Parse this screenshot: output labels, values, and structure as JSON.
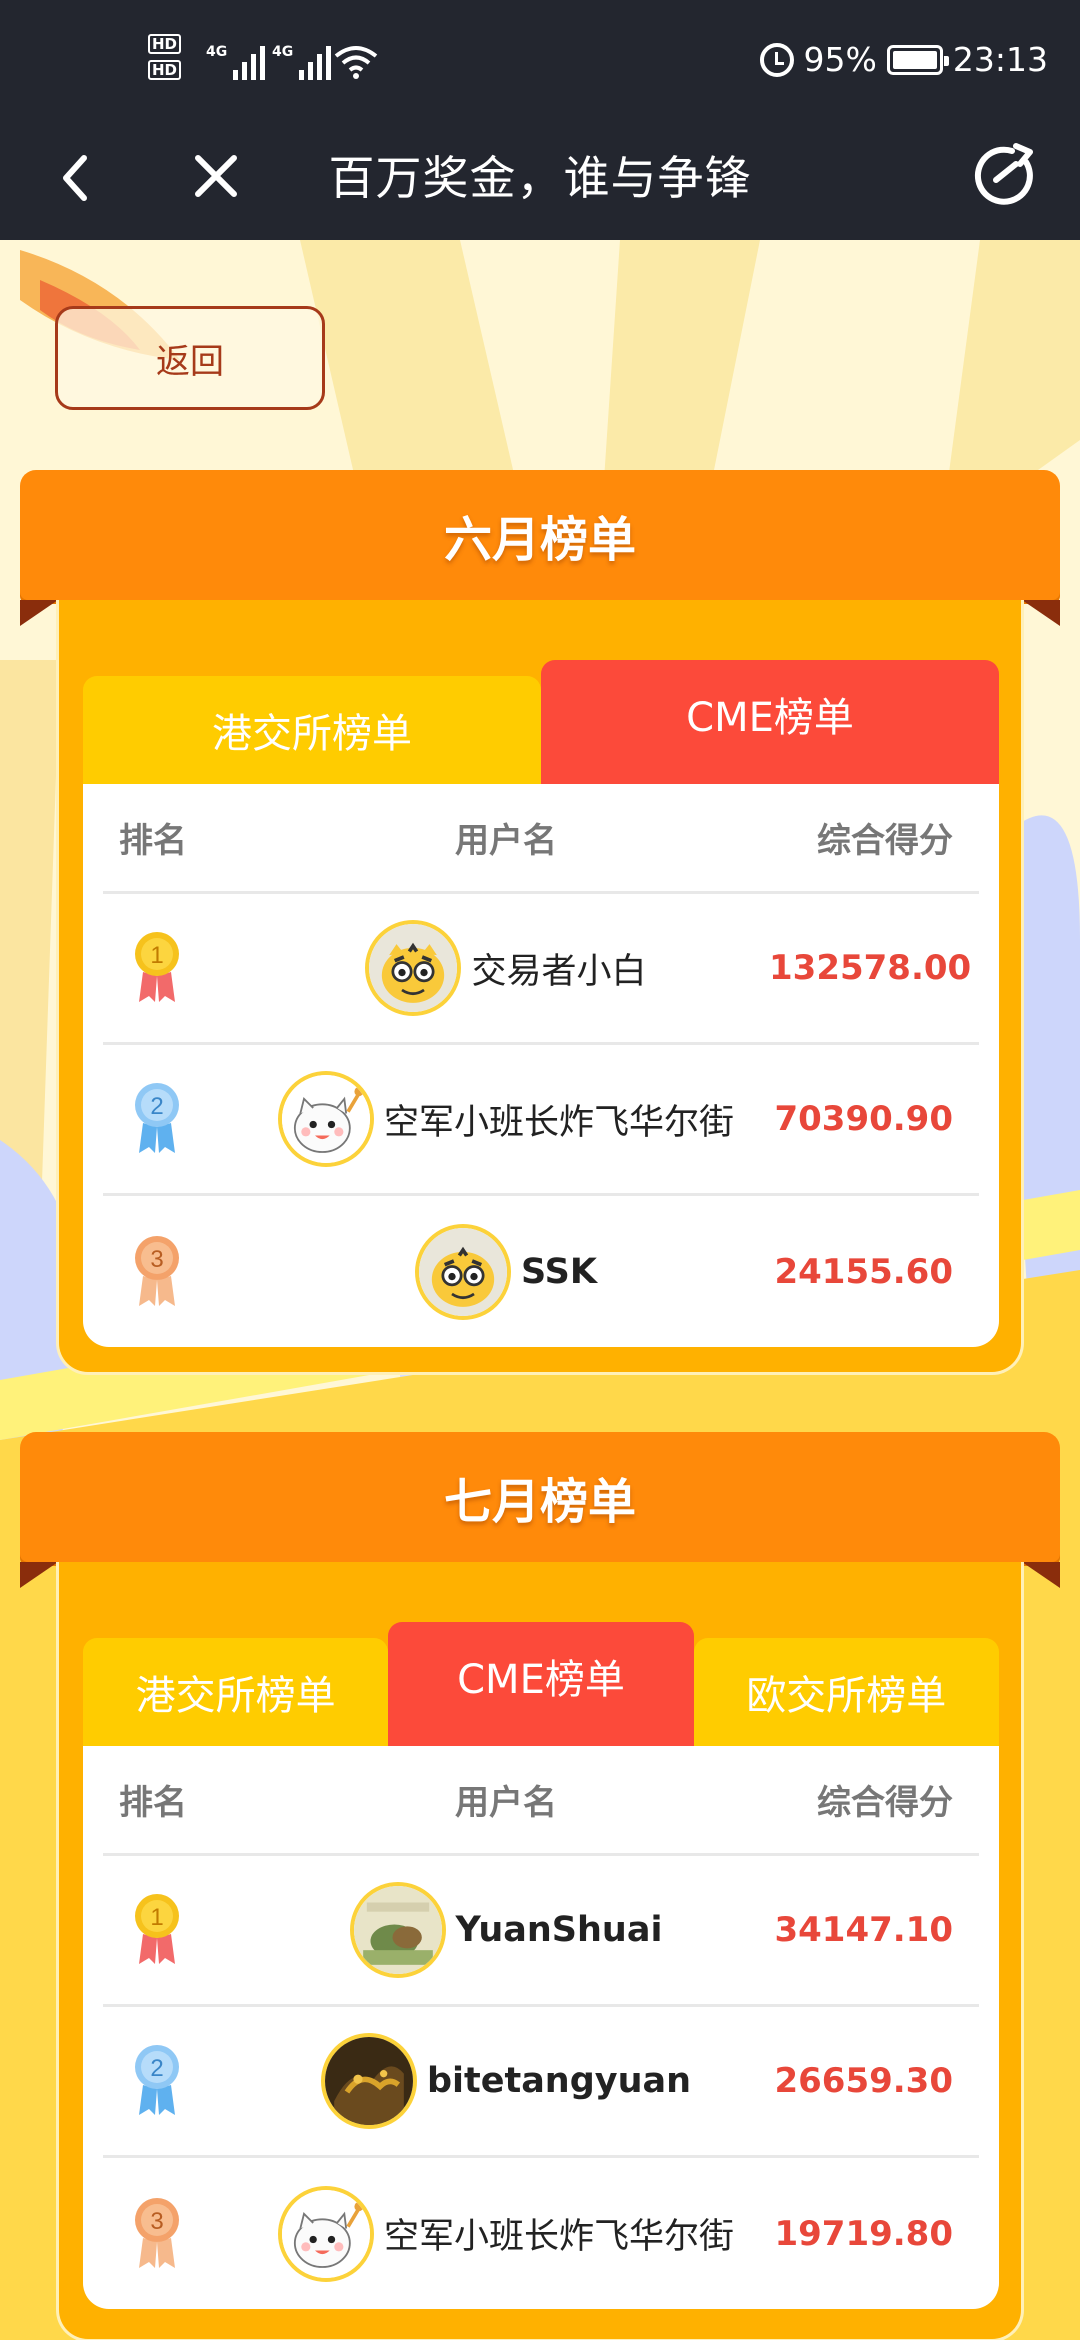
{
  "status_bar": {
    "hd1": "HD",
    "hd2": "HD",
    "net1": "4G",
    "net2": "4G",
    "battery": "95%",
    "time": "23:13"
  },
  "navbar": {
    "title": "百万奖金，谁与争锋"
  },
  "back_button": {
    "label": "返回"
  },
  "colors": {
    "header_orange": "#ff8a0a",
    "tab_yellow": "#ffcc00",
    "tab_active_red": "#fc4a3a",
    "score_red": "#e8473a",
    "medal_gold": "#f6c21c",
    "medal_silver": "#8fc8f5",
    "medal_bronze": "#f4a26a"
  },
  "boards": [
    {
      "title": "六月榜单",
      "tabs": [
        "港交所榜单",
        "CME榜单"
      ],
      "active_tab": "CME榜单",
      "columns": {
        "rank": "排名",
        "user": "用户名",
        "score": "综合得分"
      },
      "rows": [
        {
          "rank": "1",
          "medal": "gold",
          "avatar": "tiger",
          "name": "交易者小白",
          "score": "132578.00"
        },
        {
          "rank": "2",
          "medal": "silver",
          "avatar": "cat",
          "name": "空军小班长炸飞华尔街",
          "score": "70390.90"
        },
        {
          "rank": "3",
          "medal": "bronze",
          "avatar": "tiger",
          "name": "SSK",
          "score": "24155.60"
        }
      ]
    },
    {
      "title": "七月榜单",
      "tabs": [
        "港交所榜单",
        "CME榜单",
        "欧交所榜单"
      ],
      "active_tab": "CME榜单",
      "columns": {
        "rank": "排名",
        "user": "用户名",
        "score": "综合得分"
      },
      "rows": [
        {
          "rank": "1",
          "medal": "gold",
          "avatar": "painting",
          "name": "YuanShuai",
          "score": "34147.10"
        },
        {
          "rank": "2",
          "medal": "silver",
          "avatar": "dark-photo",
          "name": "bitetangyuan",
          "score": "26659.30"
        },
        {
          "rank": "3",
          "medal": "bronze",
          "avatar": "cat",
          "name": "空军小班长炸飞华尔街",
          "score": "19719.80"
        }
      ]
    }
  ]
}
